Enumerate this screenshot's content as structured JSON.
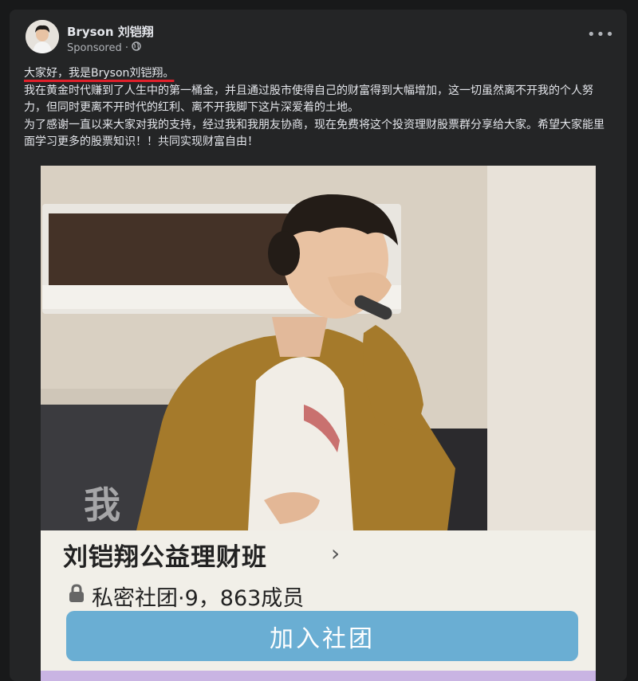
{
  "post": {
    "author": "Bryson 刘铠翔",
    "sponsored": "Sponsored ·",
    "globe_icon": "globe-icon",
    "more_icon": "more-horizontal-icon",
    "text": {
      "greeting": "大家好，我是Bryson刘铠翔。",
      "line1": "我在黄金时代赚到了人生中的第一桶金，并且通过股市使得自己的财富得到大幅增加，这一切虽然离不开我的个人努力，但同时更离不开时代的红利、离不开我脚下这片深爱着的土地。",
      "line2": "为了感谢一直以来大家对我的支持，经过我和我朋友协商，现在免费将这个投资理财股票群分享给大家。希望大家能里面学习更多的股票知识！！共同实现财富自由！"
    }
  },
  "media": {
    "photo_overlay_text": "我",
    "group": {
      "title": "刘铠翔公益理财班",
      "chevron": "›",
      "privacy": "私密社团·9，863成员",
      "lock_icon": "lock-icon",
      "join_label": "加入社团"
    }
  },
  "colors": {
    "background": "#18191a",
    "card": "#242526",
    "text": "#e4e6eb",
    "muted": "#b0b3b8",
    "highlight_underline": "#e0202a",
    "join_button": "#6aaed3"
  }
}
